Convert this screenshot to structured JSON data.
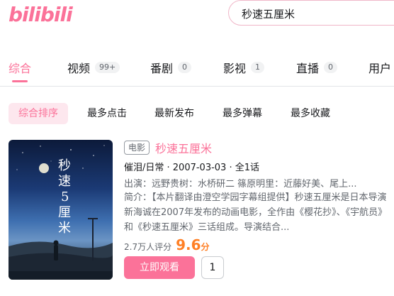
{
  "app": {
    "logo_text": "bilibili",
    "brand_color": "#fb7299"
  },
  "search": {
    "value": "秒速五厘米"
  },
  "tabs": [
    {
      "label": "综合",
      "count": ""
    },
    {
      "label": "视频",
      "count": "99+"
    },
    {
      "label": "番剧",
      "count": "0"
    },
    {
      "label": "影视",
      "count": "1"
    },
    {
      "label": "直播",
      "count": "0"
    },
    {
      "label": "用户",
      "count": ""
    }
  ],
  "sort_options": [
    "综合排序",
    "最多点击",
    "最新发布",
    "最多弹幕",
    "最多收藏"
  ],
  "result": {
    "tag": "电影",
    "title": "秒速五厘米",
    "meta": "催泪/日常 · 2007-03-03 · 全1话",
    "cast": "出演：远野贵树：水桥研二 篠原明里：近藤好美、尾上...",
    "desc": "简介：【本片翻译由澄空学园字幕组提供】秒速五厘米是日本导演新海诚在2007年发布的动画电影，全作由《樱花抄》、《宇航员》和《秒速五厘米》三话组成。导演结合...",
    "rating_text": "2.7万人评分",
    "score": "9.6",
    "score_unit": "分",
    "watch_label": "立即观看",
    "episode_label": "1",
    "score_color": "#ff7f24"
  }
}
